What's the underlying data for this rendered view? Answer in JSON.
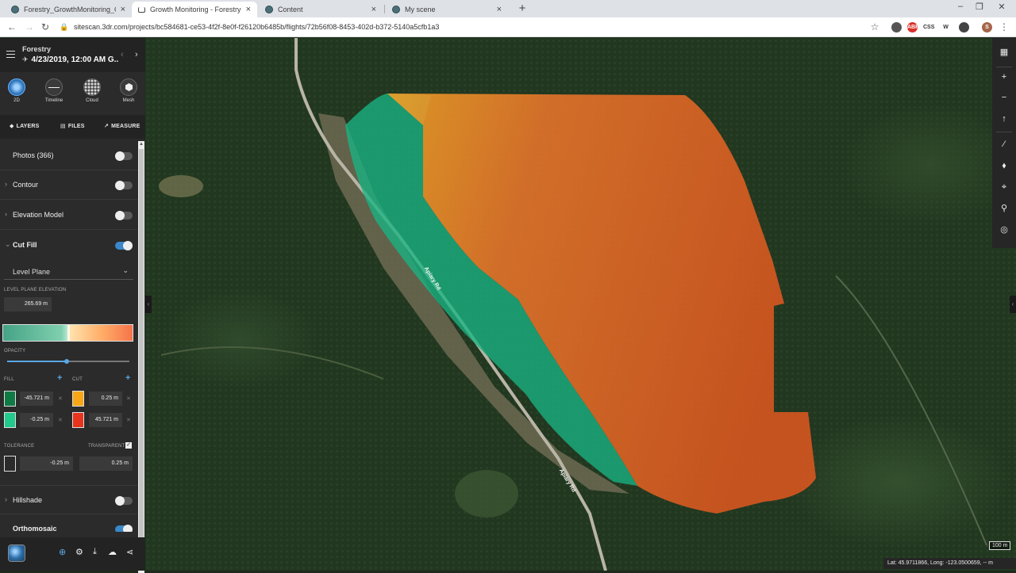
{
  "browser": {
    "tabs": [
      {
        "title": "Forestry_GrowthMonitoring_Ortho",
        "active": false
      },
      {
        "title": "Growth Monitoring - Forestry | 3D",
        "active": true
      },
      {
        "title": "Content",
        "active": false
      },
      {
        "title": "My scene",
        "active": false
      }
    ],
    "url": "sitescan.3dr.com/projects/bc584681-ce53-4f2f-8e0f-f26120b6485b/flights/72b56f08-8453-402d-b372-5140a5cfb1a3",
    "new_tab": "+",
    "extensions": [
      "ABP",
      "CSS",
      "W",
      "S"
    ]
  },
  "sidebar": {
    "project": "Forestry",
    "flight_date": "4/23/2019, 12:00 AM  G..",
    "views": [
      {
        "label": "2D",
        "icon": "fingerprint-icon"
      },
      {
        "label": "Timeline",
        "icon": "timeline-icon"
      },
      {
        "label": "Cloud",
        "icon": "cloud-icon"
      },
      {
        "label": "Mesh",
        "icon": "mesh-icon"
      }
    ],
    "tabs": [
      {
        "label": "LAYERS",
        "icon": "layers-icon"
      },
      {
        "label": "FILES",
        "icon": "files-icon"
      },
      {
        "label": "MEASURE",
        "icon": "measure-icon"
      }
    ],
    "layers": {
      "photos": {
        "label": "Photos (366)",
        "on": false
      },
      "contour": {
        "label": "Contour",
        "on": false
      },
      "elevation": {
        "label": "Elevation Model",
        "on": false
      },
      "cutfill": {
        "label": "Cut Fill",
        "on": true
      },
      "hillshade": {
        "label": "Hillshade",
        "on": false
      },
      "orthomosaic": {
        "label": "Orthomosaic",
        "on": true
      }
    },
    "cutfill": {
      "mode": "Level Plane",
      "level_plane_label": "LEVEL PLANE ELEVATION",
      "level_plane_value": "265.69 m",
      "opacity_label": "OPACITY",
      "opacity": 0.49,
      "fill_label": "FILL",
      "cut_label": "CUT",
      "fill_colors": [
        "#0f7a45",
        "#22c98c"
      ],
      "cut_colors": [
        "#f7a616",
        "#e8341c"
      ],
      "fill_values": [
        "-45.721 m",
        "-0.25 m"
      ],
      "cut_values": [
        "0.25 m",
        "45.721 m"
      ],
      "tolerance_label": "TOLERANCE",
      "transparent_label": "TRANSPARENT",
      "transparent_checked": true,
      "tolerance_low": "-0.25 m",
      "tolerance_high": "0.25 m"
    }
  },
  "map": {
    "road_label_1": "Apiary Rd",
    "road_label_2": "Apiary Rd",
    "scale": "100 m",
    "coords": "Lat: 45.9711866, Long: -123.0500659,  -- m"
  }
}
